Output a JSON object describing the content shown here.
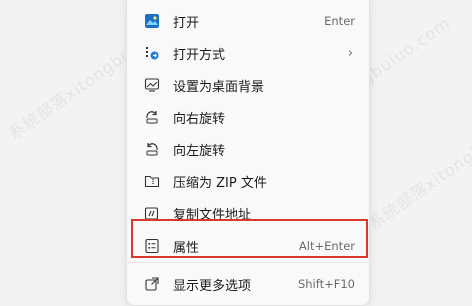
{
  "menu": {
    "items": [
      {
        "name": "open",
        "icon": "photos-app-icon",
        "label": "打开",
        "shortcut": "Enter"
      },
      {
        "name": "open-with",
        "icon": "open-with-icon",
        "label": "打开方式",
        "submenu": "›"
      },
      {
        "name": "set-background",
        "icon": "set-desktop-background-icon",
        "label": "设置为桌面背景"
      },
      {
        "name": "rotate-right",
        "icon": "rotate-right-icon",
        "label": "向右旋转"
      },
      {
        "name": "rotate-left",
        "icon": "rotate-left-icon",
        "label": "向左旋转"
      },
      {
        "name": "compress-zip",
        "icon": "zip-folder-icon",
        "label": "压缩为 ZIP 文件"
      },
      {
        "name": "copy-path",
        "icon": "copy-path-icon",
        "label": "复制文件地址"
      },
      {
        "name": "properties",
        "icon": "properties-icon",
        "label": "属性",
        "shortcut": "Alt+Enter"
      },
      {
        "name": "more-options",
        "icon": "more-options-icon",
        "label": "显示更多选项",
        "shortcut": "Shift+F10"
      }
    ]
  },
  "watermark": "系统部落xitongbuluo.com",
  "colors": {
    "highlight_border": "#d9382e",
    "menu_bg": "#f9f9f9",
    "page_bg": "#f3f3f3"
  }
}
